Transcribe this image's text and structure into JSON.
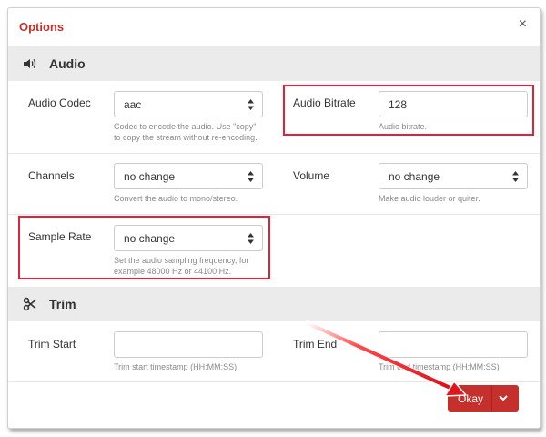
{
  "dialog": {
    "title": "Options",
    "close_icon": "close-icon"
  },
  "audio": {
    "section_label": "Audio",
    "section_icon": "speaker-icon",
    "codec": {
      "label": "Audio Codec",
      "value": "aac",
      "help": [
        "Codec to encode the audio. Use \"copy\"",
        "to copy the stream without re-encoding."
      ]
    },
    "bitrate": {
      "label": "Audio Bitrate",
      "value": "128",
      "help": "Audio bitrate."
    },
    "channels": {
      "label": "Channels",
      "value": "no change",
      "help": "Convert the audio to mono/stereo."
    },
    "volume": {
      "label": "Volume",
      "value": "no change",
      "help": "Make audio louder or quiter."
    },
    "sample_rate": {
      "label": "Sample Rate",
      "value": "no change",
      "help": [
        "Set the audio sampling frequency, for",
        "example 48000 Hz or 44100 Hz."
      ]
    }
  },
  "trim": {
    "section_label": "Trim",
    "section_icon": "scissors-icon",
    "start": {
      "label": "Trim Start",
      "value": "",
      "help": "Trim start timestamp (HH:MM:SS)"
    },
    "end": {
      "label": "Trim End",
      "value": "",
      "help": "Trim end timestamp (HH:MM:SS)"
    }
  },
  "footer": {
    "ok_label": "Okay",
    "dropdown_icon": "chevron-down-icon"
  },
  "colors": {
    "accent": "#c0312b",
    "button": "#c5302c",
    "highlight": "#e0223a",
    "section_bg": "#ebebeb"
  }
}
